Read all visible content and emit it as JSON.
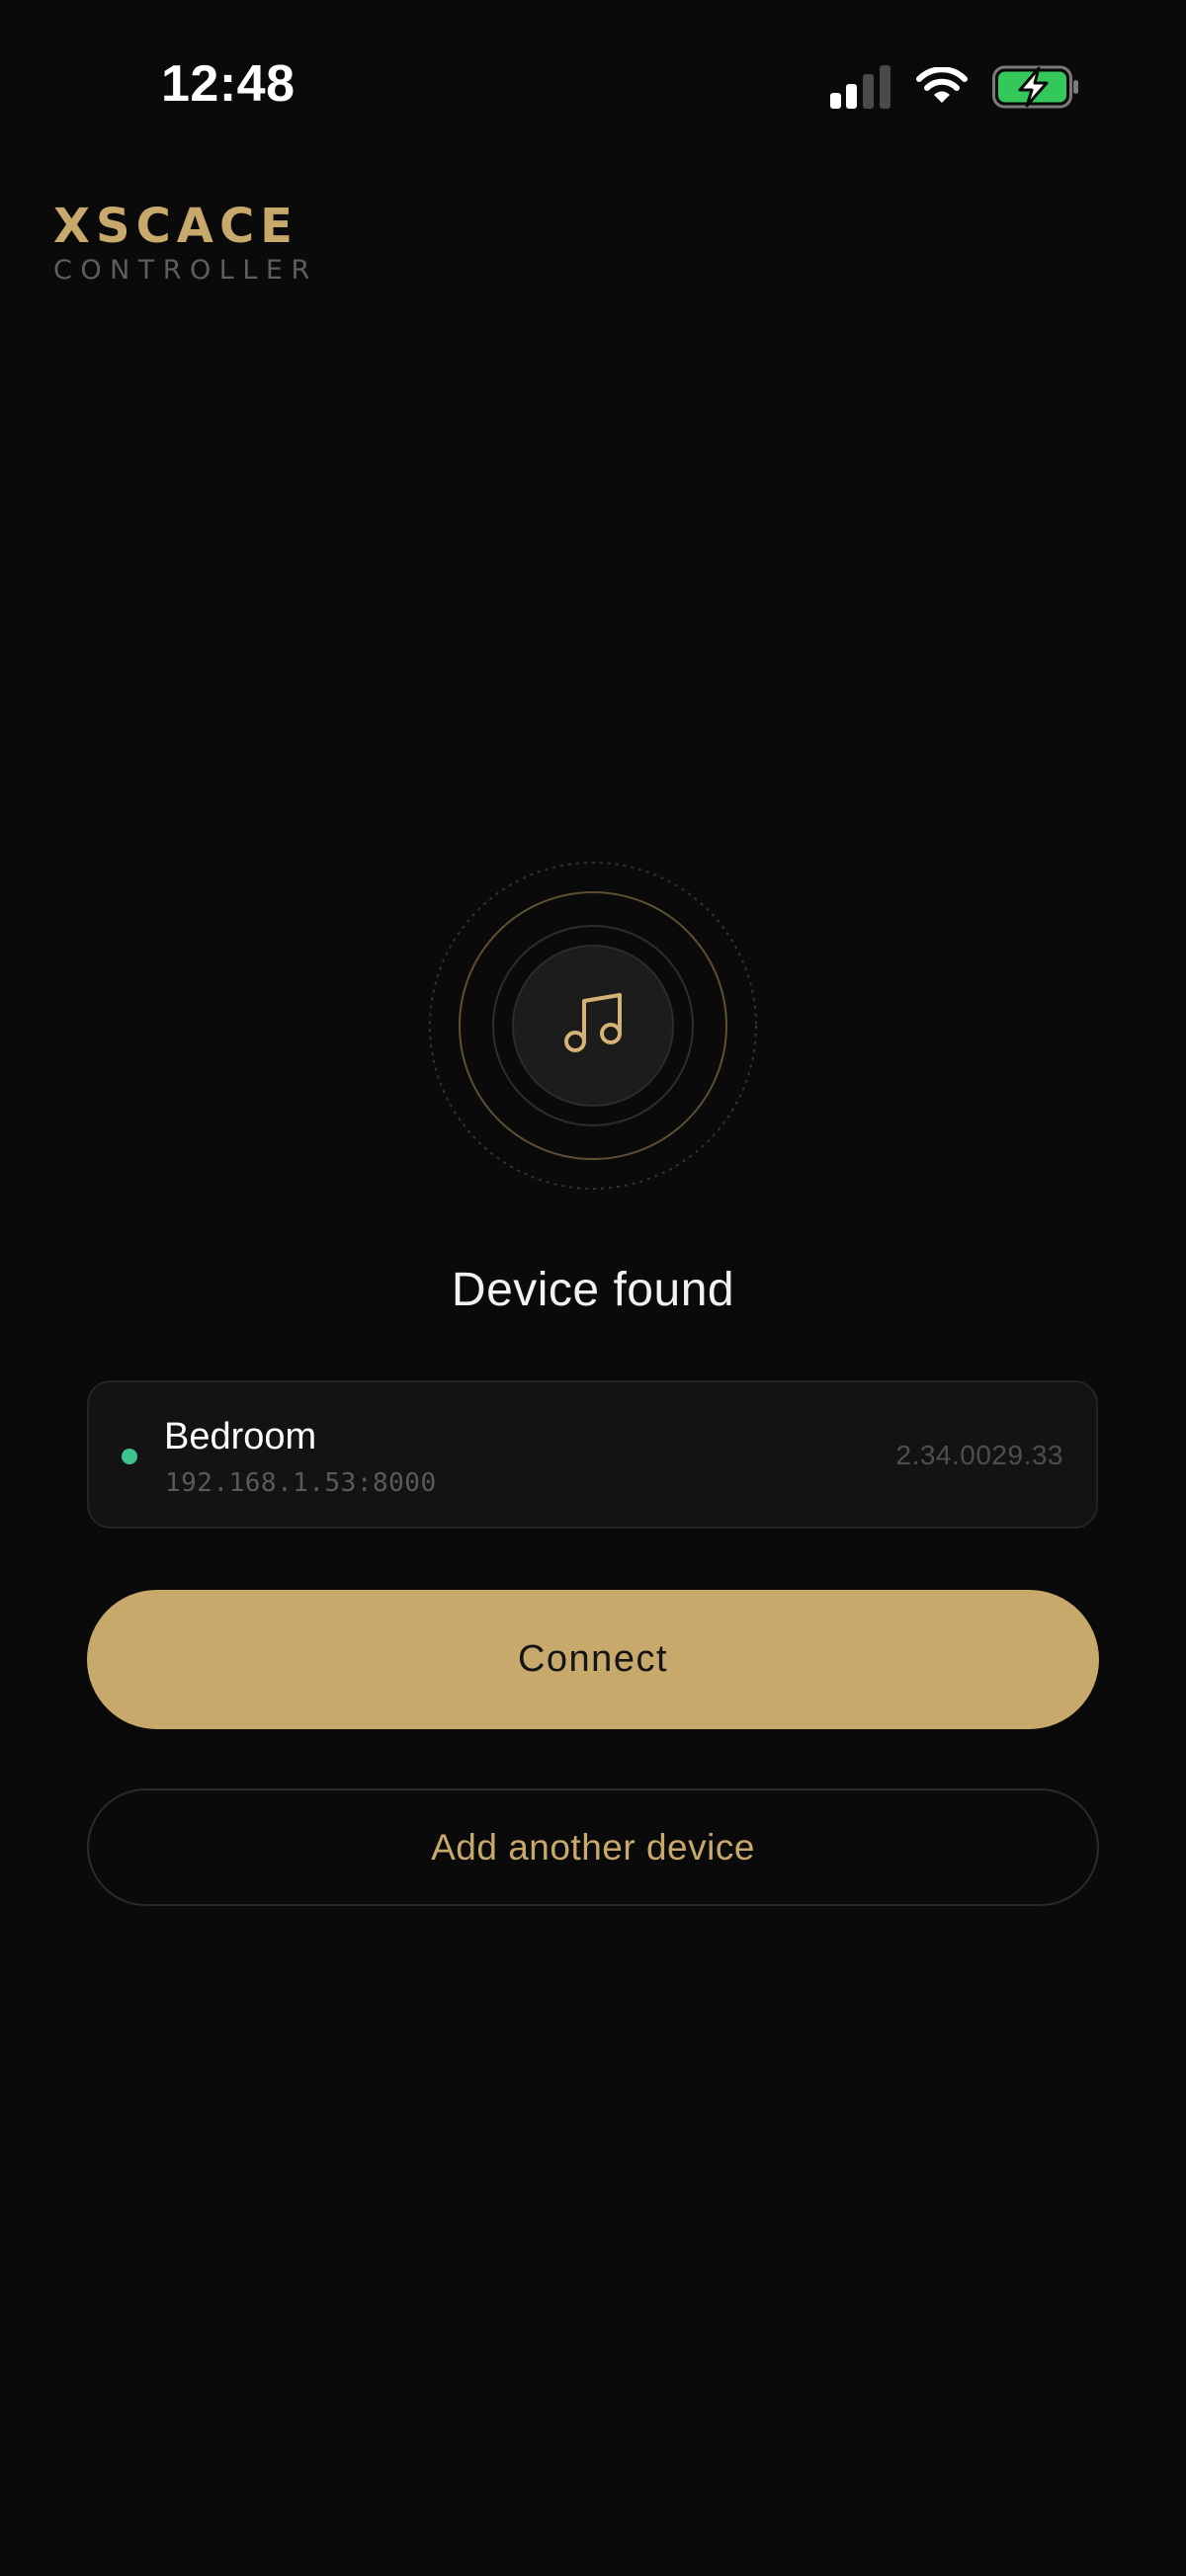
{
  "status_bar": {
    "time": "12:48",
    "icons": [
      "cellular-signal-icon",
      "wifi-icon",
      "battery-charging-icon"
    ],
    "battery_color": "#34c759"
  },
  "brand": {
    "wordmark": "XSCACE",
    "subtitle": "CONTROLLER",
    "accent_color": "#c8a96c"
  },
  "discovery": {
    "icon": "music-note-icon",
    "status": "Device found"
  },
  "device": {
    "name": "Bedroom",
    "address": "192.168.1.53:8000",
    "version": "2.34.0029.33",
    "online_color": "#3ec28f"
  },
  "actions": {
    "connect_label": "Connect",
    "add_device_label": "Add another device"
  }
}
